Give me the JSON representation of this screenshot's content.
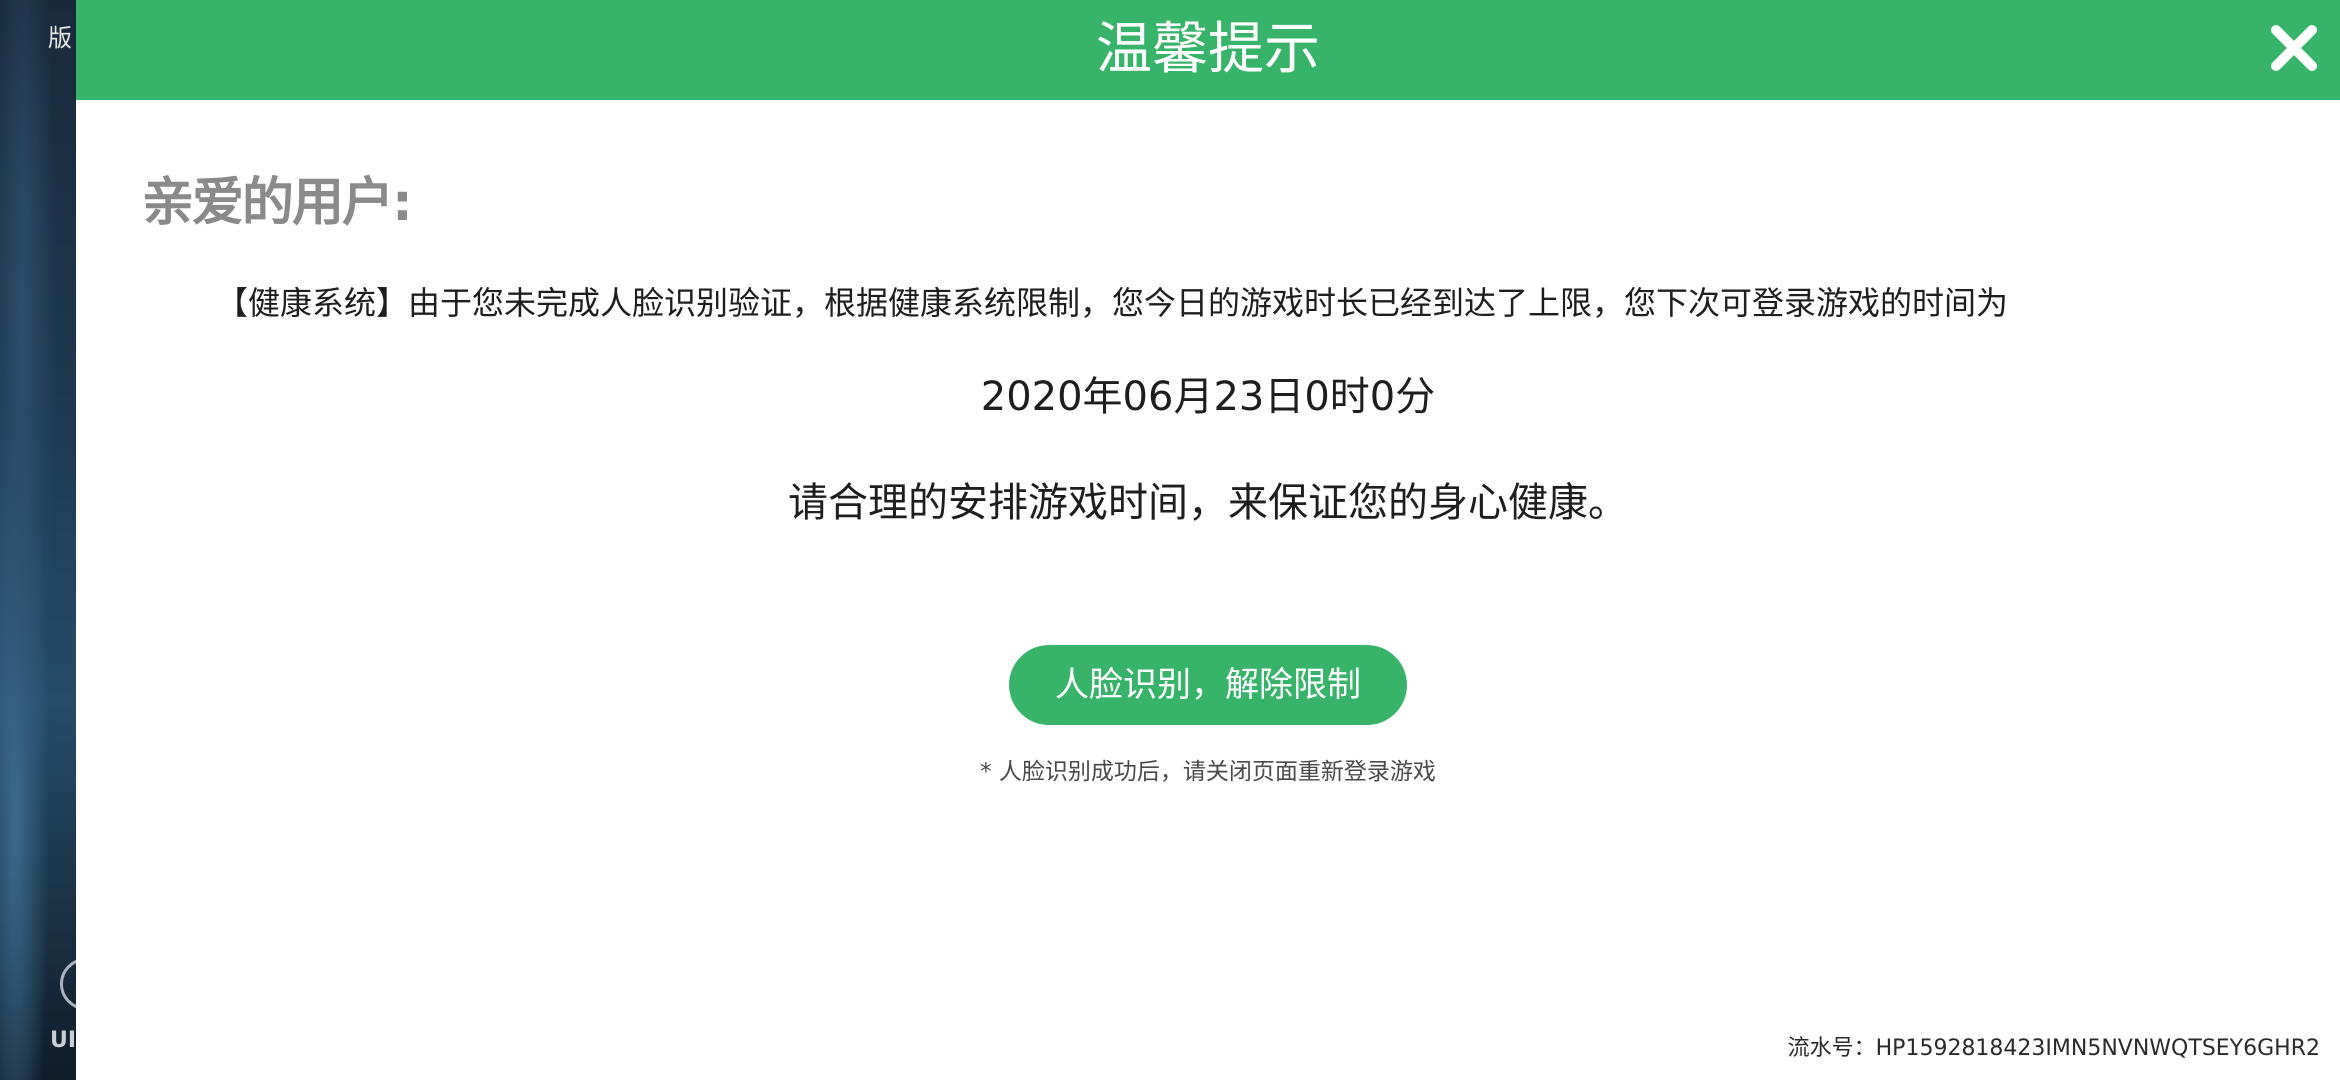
{
  "background": {
    "top_text": "版",
    "bottom_text": "UI"
  },
  "dialog": {
    "title": "温馨提示",
    "greeting": "亲爱的用户:",
    "notice": "【健康系统】由于您未完成人脸识别验证，根据健康系统限制，您今日的游戏时长已经到达了上限，您下次可登录游戏的时间为",
    "next_login_time": "2020年06月23日0时0分",
    "advice": "请合理的安排游戏时间，来保证您的身心健康。",
    "face_button_label": "人脸识别，解除限制",
    "hint": "* 人脸识别成功后，请关闭页面重新登录游戏",
    "serial": "流水号：HP1592818423IMN5NVNWQTSEY6GHR2",
    "close_icon": "close-icon"
  },
  "colors": {
    "accent": "#38b46a",
    "greeting": "#8a8a8a",
    "text": "#1e1e1e"
  }
}
